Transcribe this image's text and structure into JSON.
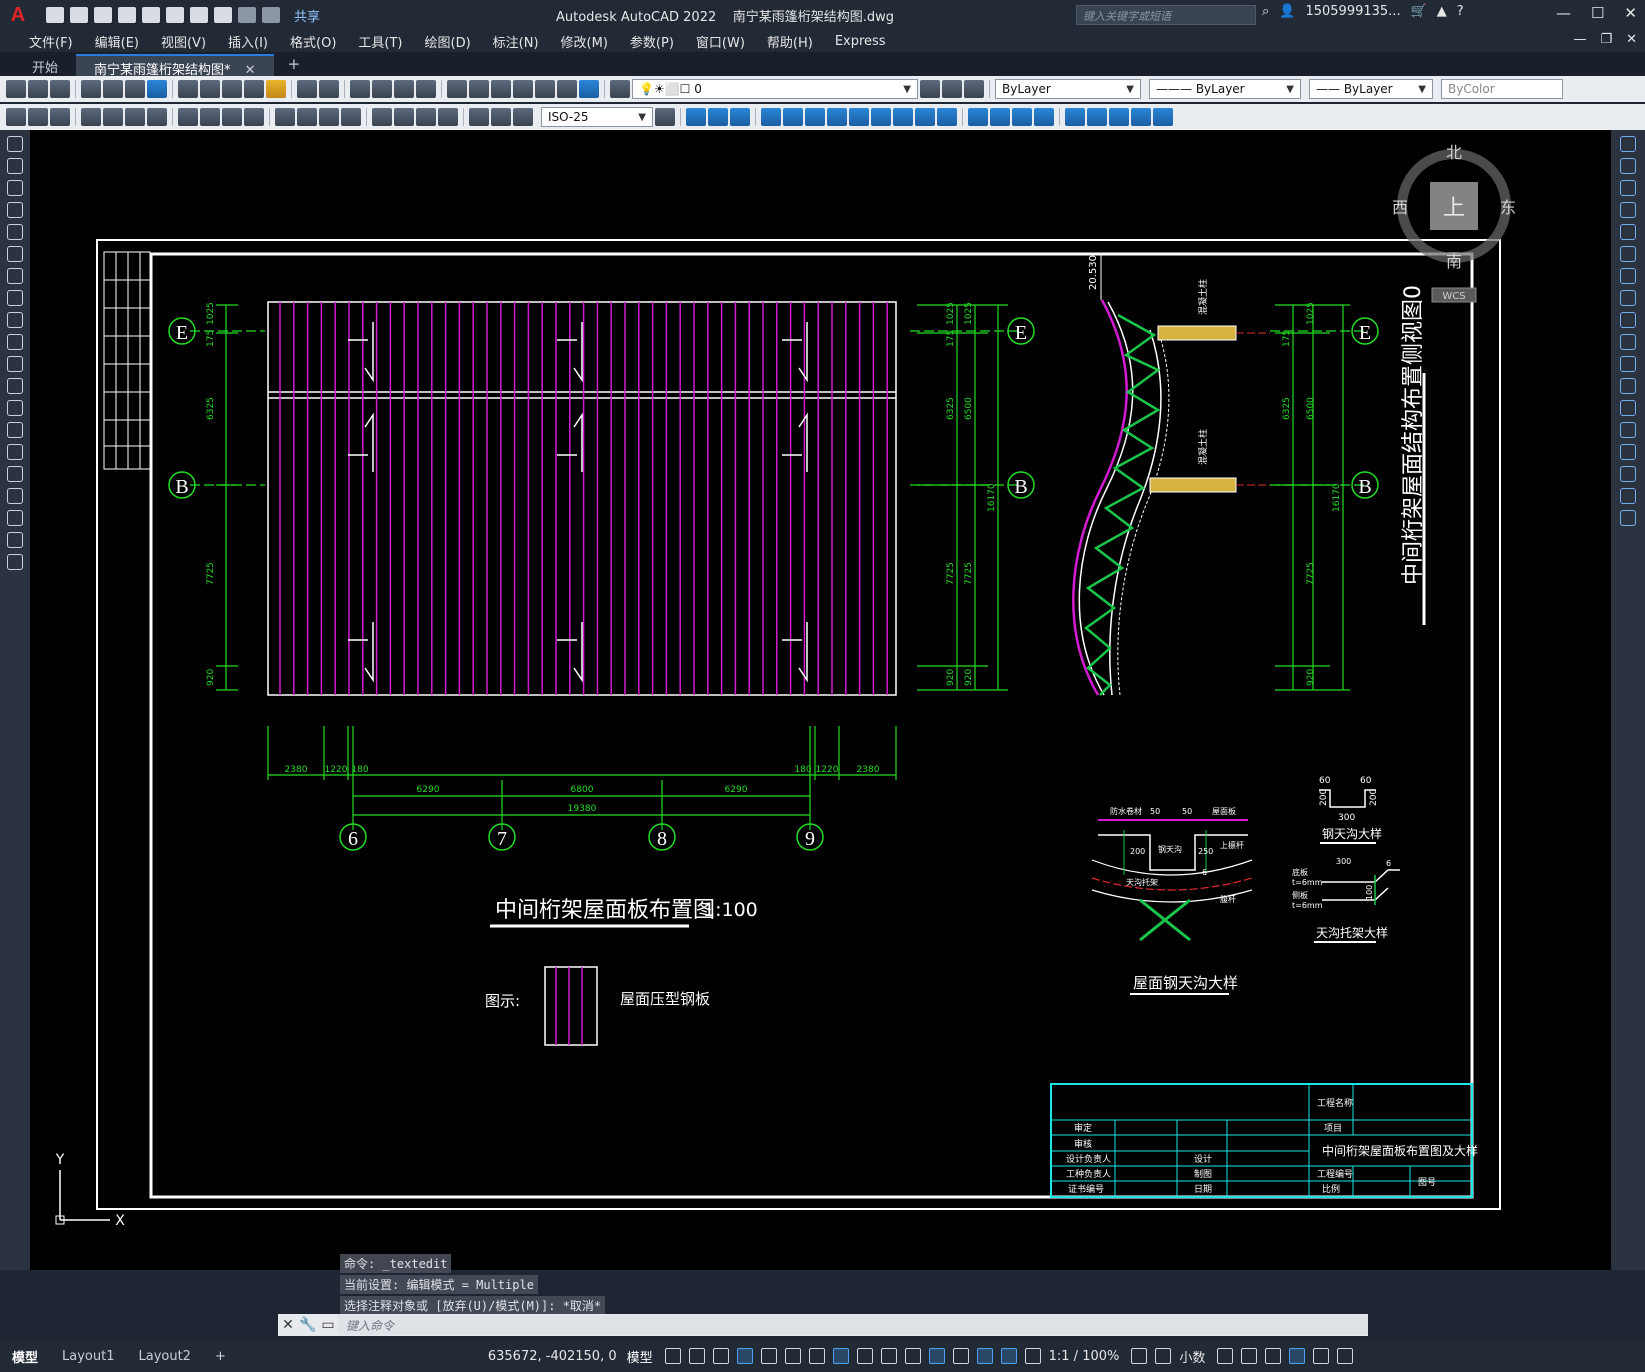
{
  "app": {
    "title": "Autodesk AutoCAD 2022",
    "filename": "南宁某雨篷桁架结构图.dwg",
    "share_label": "共享",
    "search_placeholder": "键入关键字或短语",
    "user": "1505999135...",
    "logo": "A"
  },
  "menu": [
    "文件(F)",
    "编辑(E)",
    "视图(V)",
    "插入(I)",
    "格式(O)",
    "工具(T)",
    "绘图(D)",
    "标注(N)",
    "修改(M)",
    "参数(P)",
    "窗口(W)",
    "帮助(H)",
    "Express"
  ],
  "tabs": {
    "start": "开始",
    "active": "南宁某雨篷桁架结构图*",
    "close": "✕",
    "add": "+"
  },
  "toolbar": {
    "layer_value": "0",
    "dimstyle_value": "ISO-25",
    "color_value": "ByLayer",
    "linetype_value": "ByLayer",
    "lineweight_value": "ByLayer",
    "plotstyle_value": "ByColor"
  },
  "viewcube": {
    "north": "北",
    "south": "南",
    "east": "东",
    "west": "西",
    "face": "上",
    "wcs": "WCS"
  },
  "drawing": {
    "grid_labels": [
      "E",
      "B"
    ],
    "axis_labels": [
      "6",
      "7",
      "8",
      "9"
    ],
    "dims_left": [
      "1025",
      "175",
      "6325",
      "7725",
      "920"
    ],
    "dims_mid": [
      "1025",
      "175",
      "6325",
      "6500",
      "7725",
      "7725",
      "920",
      "920",
      "16170"
    ],
    "dims_right": [
      "1025",
      "175",
      "6325",
      "6500",
      "7725",
      "920",
      "16170"
    ],
    "dims_bottom_top": [
      "2380",
      "1220",
      "180",
      "180",
      "1220",
      "2380"
    ],
    "dims_bottom_axes": [
      "6290",
      "6800",
      "6290"
    ],
    "dims_total": "19380",
    "elevation_top": "20.530",
    "column_label": "混凝土柱",
    "plan_title": "中间桁架屋面板布置图",
    "plan_scale": "1:100",
    "legend_label": "图示:",
    "legend_text": "屋面压型钢板",
    "side_title": "中间桁架屋面结构布置侧视图0",
    "gutter_title": "屋面钢天沟大样",
    "gutter_labels": [
      "防水卷材",
      "50",
      "50",
      "屋面板",
      "200",
      "钢天沟",
      "250",
      "上檩杆",
      "天沟托架",
      "6",
      "腹杆"
    ],
    "steel_gutter_title": "钢天沟大样",
    "steel_gutter_dims": [
      "60",
      "60",
      "200",
      "200",
      "300"
    ],
    "bracket_title": "天沟托架大样",
    "bracket_labels": [
      "底板",
      "t=6mm",
      "侧板",
      "t=6mm",
      "300",
      "6",
      "100"
    ]
  },
  "titleblock": {
    "project_name_label": "工程名称",
    "project_label": "项目",
    "drawing_title": "中间桁架屋面板布置图及大样",
    "rows": [
      "审定",
      "审核",
      "设计负责人",
      "工种负责人",
      "证书编号"
    ],
    "mid": [
      "设计",
      "制图",
      "日期"
    ],
    "right": [
      "工程编号",
      "比例"
    ],
    "sheet_label": "图号"
  },
  "command": {
    "history": [
      "命令: _textedit",
      "当前设置: 编辑模式 = Multiple",
      "选择注释对象或 [放弃(U)/模式(M)]: *取消*"
    ],
    "placeholder": "键入命令"
  },
  "statusbar": {
    "model_tab": "模型",
    "layout1": "Layout1",
    "layout2": "Layout2",
    "add": "+",
    "coords": "635672, -402150, 0",
    "mode": "模型",
    "scale": "1:1 / 100%",
    "units": "小数"
  },
  "ucs": {
    "y": "Y",
    "x": "X"
  },
  "colors": {
    "canvas": "#000000",
    "grid_green": "#22dd22",
    "panel_magenta": "#d21bd2",
    "titleblock_cyan": "#19e6e6",
    "truss_green": "#19c64b"
  }
}
